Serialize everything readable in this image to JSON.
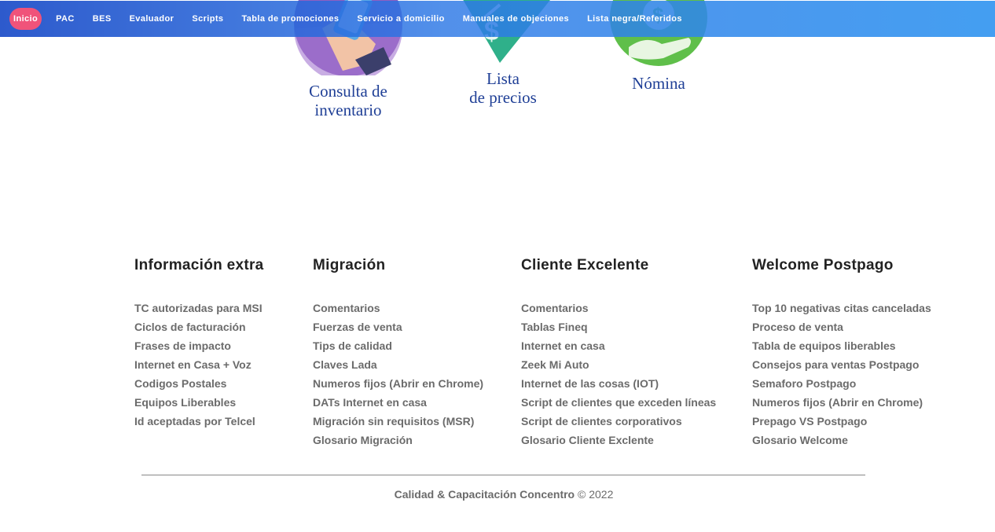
{
  "nav": {
    "items": [
      {
        "label": "Inicio",
        "active": true
      },
      {
        "label": "PAC"
      },
      {
        "label": "BES"
      },
      {
        "label": "Evaluador"
      },
      {
        "label": "Scripts"
      },
      {
        "label": "Tabla de promociones"
      },
      {
        "label": "Servicio a domicilio"
      },
      {
        "label": "Manuales de objeciones"
      },
      {
        "label": "Lista negra/Referidos"
      }
    ],
    "active_color": "#f0537a"
  },
  "hero": {
    "tiles": [
      {
        "label": "Consulta de\ninventario",
        "icon": "phone-in-hand-icon",
        "color": "#8f5fc0"
      },
      {
        "label": "Lista\nde precios",
        "icon": "price-tag-icon",
        "color": "#2fb08a"
      },
      {
        "label": "Nómina",
        "icon": "money-hand-icon",
        "color": "#5fbf4a"
      }
    ],
    "label_color": "#1f3f96"
  },
  "footer": {
    "columns": [
      {
        "title": "Información extra",
        "links": [
          "TC autorizadas para MSI",
          "Ciclos de facturación",
          "Frases de impacto",
          "Internet en Casa + Voz",
          "Codigos Postales",
          "Equipos Liberables",
          "Id aceptadas por Telcel"
        ]
      },
      {
        "title": "Migración",
        "links": [
          "Comentarios",
          "Fuerzas de venta",
          "Tips de calidad",
          "Claves Lada",
          "Numeros fijos (Abrir en Chrome)",
          "DATs Internet en casa",
          "Migración sin requisitos (MSR)",
          "Glosario Migración"
        ]
      },
      {
        "title": "Cliente Excelente",
        "links": [
          "Comentarios",
          "Tablas Fineq",
          "Internet en casa",
          "Zeek Mi Auto",
          "Internet de las cosas (IOT)",
          "Script de clientes que exceden líneas",
          "Script de clientes corporativos",
          "Glosario Cliente Exclente"
        ]
      },
      {
        "title": "Welcome Postpago",
        "links": [
          "Top 10 negativas citas canceladas",
          "Proceso de venta",
          "Tabla de equipos liberables",
          "Consejos para ventas Postpago",
          "Semaforo Postpago",
          "Numeros fijos (Abrir en Chrome)",
          "Prepago VS Postpago",
          "Glosario Welcome"
        ]
      }
    ],
    "copyright_brand": "Calidad & Capacitación Concentro",
    "copyright_suffix": "© 2022"
  }
}
